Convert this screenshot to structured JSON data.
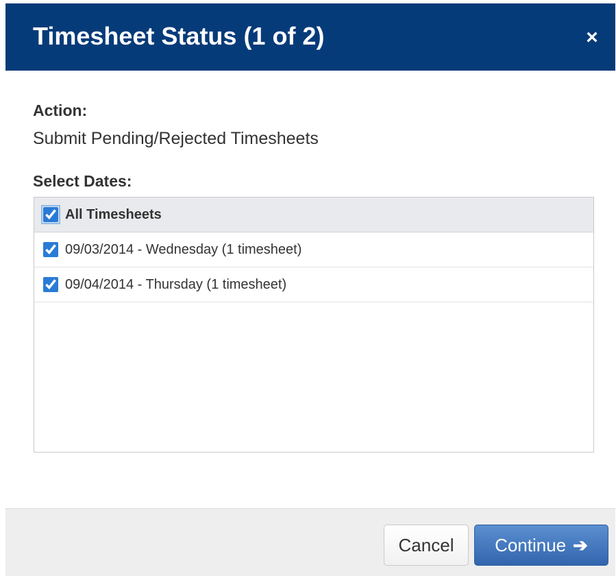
{
  "dialog": {
    "title": "Timesheet Status (1 of 2)",
    "close_icon": "×"
  },
  "action": {
    "label": "Action:",
    "value": "Submit Pending/Rejected Timesheets"
  },
  "dates": {
    "label": "Select Dates:",
    "all": {
      "label": "All Timesheets",
      "checked": true
    },
    "items": [
      {
        "label": "09/03/2014 - Wednesday (1 timesheet)",
        "checked": true
      },
      {
        "label": "09/04/2014 - Thursday (1 timesheet)",
        "checked": true
      }
    ]
  },
  "footer": {
    "cancel_label": "Cancel",
    "continue_label": "Continue",
    "continue_icon": "arrow-right-icon"
  },
  "colors": {
    "header_bg": "#063b79",
    "primary": "#3a6fb8"
  }
}
